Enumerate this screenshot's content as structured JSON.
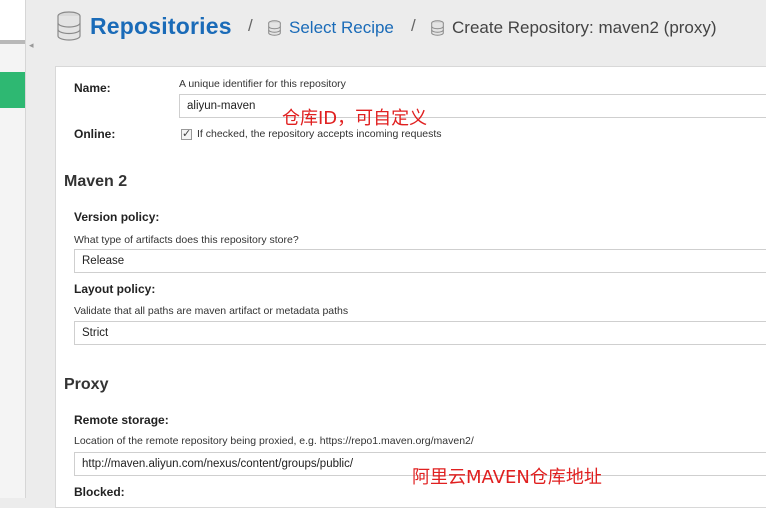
{
  "header": {
    "title": "Repositories",
    "separator": "/",
    "crumb_link": "Select Recipe",
    "crumb_current": "Create Repository: maven2 (proxy)"
  },
  "form": {
    "name": {
      "label": "Name:",
      "help": "A unique identifier for this repository",
      "value": "aliyun-maven"
    },
    "online": {
      "label": "Online:",
      "help": "If checked, the repository accepts incoming requests",
      "checked": true
    },
    "maven_section": "Maven 2",
    "version_policy": {
      "label": "Version policy:",
      "help": "What type of artifacts does this repository store?",
      "value": "Release"
    },
    "layout_policy": {
      "label": "Layout policy:",
      "help": "Validate that all paths are maven artifact or metadata paths",
      "value": "Strict"
    },
    "proxy_section": "Proxy",
    "remote_storage": {
      "label": "Remote storage:",
      "help": "Location of the remote repository being proxied, e.g. https://repo1.maven.org/maven2/",
      "value": "http://maven.aliyun.com/nexus/content/groups/public/"
    },
    "blocked": {
      "label": "Blocked:"
    }
  },
  "annotations": {
    "repo_id_note": "仓库ID，可自定义",
    "remote_note": "阿里云MAVEN仓库地址"
  },
  "colors": {
    "accent": "#1a6bb8",
    "sidebar_active": "#2eb872",
    "annotation": "#e02020"
  }
}
